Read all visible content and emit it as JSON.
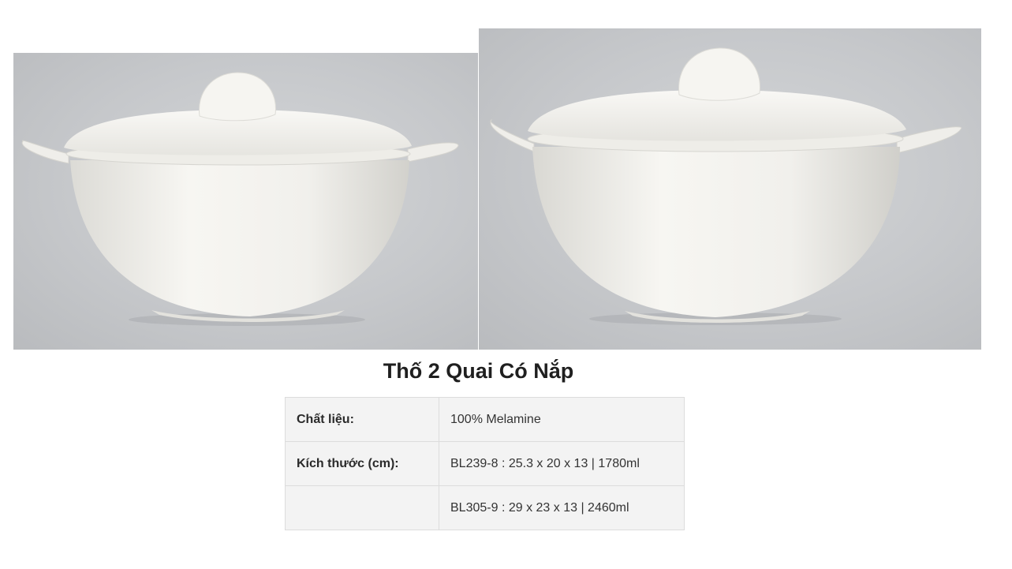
{
  "images": [
    {
      "alt": "Thố 2 quai có nắp BL239-8"
    },
    {
      "alt": "Thố 2 quai có nắp BL305-9"
    }
  ],
  "product": {
    "title": "Thố 2 Quai Có Nắp"
  },
  "specs": [
    {
      "label": "Chất liệu:",
      "value": "100% Melamine"
    },
    {
      "label": "Kích thước (cm):",
      "value": "BL239-8 : 25.3 x 20 x 13 | 1780ml"
    },
    {
      "label": "",
      "value": "BL305-9 : 29 x 23 x 13 | 2460ml"
    }
  ],
  "colors": {
    "photo_background": "#c8cacd",
    "bowl": "#f4f3ef",
    "table_background": "#f3f3f3",
    "table_border": "#dcdcdc"
  }
}
